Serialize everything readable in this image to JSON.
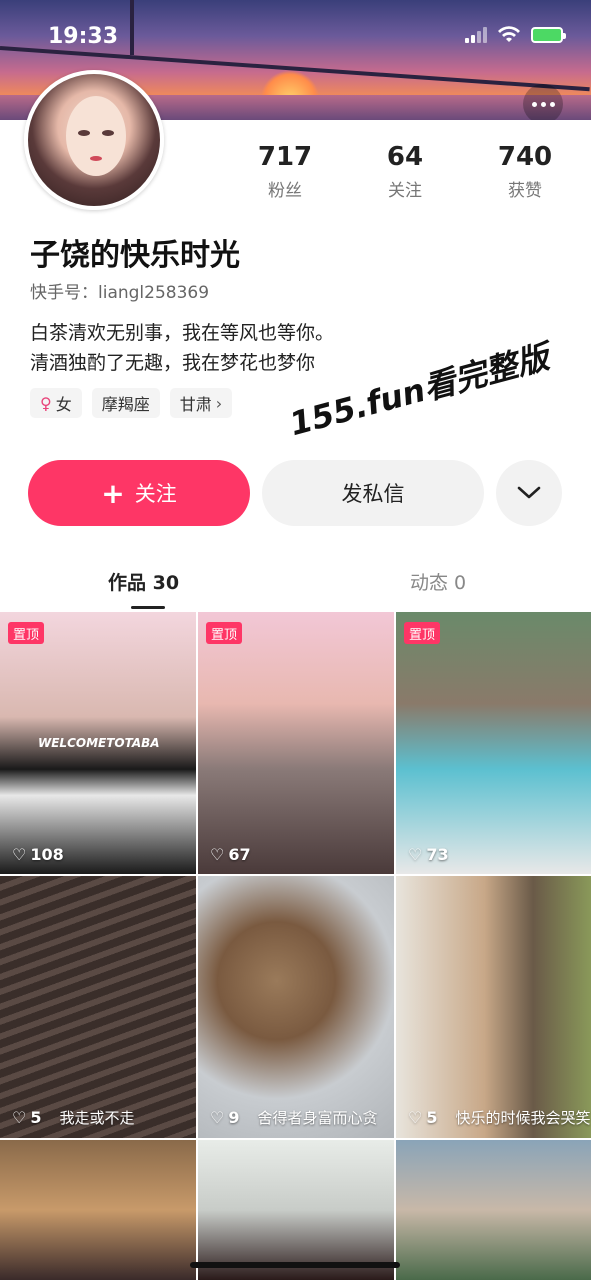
{
  "status_bar": {
    "time": "19:33"
  },
  "profile": {
    "nickname": "子饶的快乐时光",
    "user_id": "快手号：liangl258369",
    "bio_line1": "白茶清欢无别事，我在等风也等你。",
    "bio_line2": "清酒独酌了无趣，我在梦花也梦你",
    "tags": [
      {
        "label": "女",
        "icon": "female-icon"
      },
      {
        "label": "摩羯座"
      },
      {
        "label": "甘肃",
        "icon": "chevron-right-icon"
      }
    ]
  },
  "stats": [
    {
      "value": "717",
      "label": "粉丝"
    },
    {
      "value": "64",
      "label": "关注"
    },
    {
      "value": "740",
      "label": "获赞"
    }
  ],
  "watermark": "155.fun看完整版",
  "actions": {
    "follow_label": "关注",
    "message_label": "发私信"
  },
  "tabs": {
    "works": "作品 30",
    "moments": "动态 0"
  },
  "grid": [
    {
      "pinned": "置顶",
      "likes": "108",
      "caption": "",
      "overlay_text": "WELCOMETOTABA",
      "colors": [
        "#f3d6de",
        "#1a1a1a"
      ]
    },
    {
      "pinned": "置顶",
      "likes": "67",
      "caption": "",
      "colors": [
        "#f2c7d6",
        "#4a3a3a"
      ]
    },
    {
      "pinned": "置顶",
      "likes": "73",
      "caption": "",
      "colors": [
        "#6a8a6a",
        "#5cc0d0"
      ]
    },
    {
      "pinned": "",
      "likes": "5",
      "caption": "我走或不走",
      "colors": [
        "#3a2e2a",
        "#6a5a50"
      ]
    },
    {
      "pinned": "",
      "likes": "9",
      "caption": "舍得者身富而心贪",
      "colors": [
        "#c8ccd0",
        "#8a6a50"
      ]
    },
    {
      "pinned": "",
      "likes": "5",
      "caption": "快乐的时候我会哭笑",
      "colors": [
        "#e8e4dc",
        "#6a5a48"
      ]
    }
  ],
  "accent_color": "#fe3666"
}
